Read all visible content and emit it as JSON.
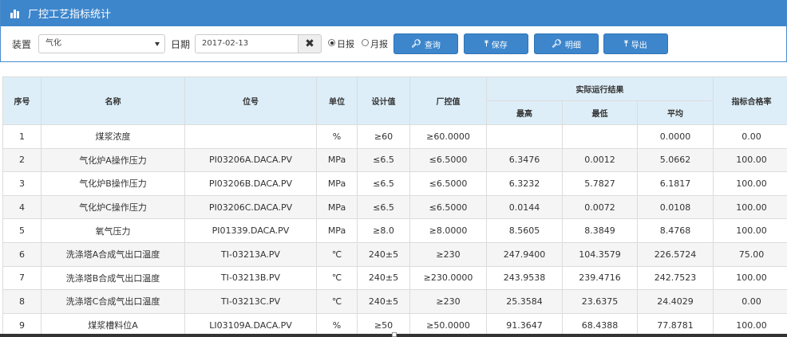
{
  "header": {
    "title": "厂控工艺指标统计",
    "icon": "bar-chart-icon"
  },
  "toolbar": {
    "device_label": "装置",
    "device_value": "气化",
    "date_label": "日期",
    "date_value": "2017-02-13",
    "clear_icon": "✖",
    "radio_day": "日报",
    "radio_month": "月报",
    "selected_radio": "日报",
    "btn_query": "查询",
    "btn_save": "保存",
    "btn_detail": "明细",
    "btn_export": "导出"
  },
  "table": {
    "headers": {
      "seq": "序号",
      "name": "名称",
      "tag": "位号",
      "unit": "单位",
      "design": "设计值",
      "control": "厂控值",
      "actual_group": "实际运行结果",
      "max": "最高",
      "min": "最低",
      "avg": "平均",
      "rate": "指标合格率"
    },
    "rows": [
      {
        "seq": "1",
        "name": "煤浆浓度",
        "tag": "",
        "unit": "%",
        "design": "≥60",
        "control": "≥60.0000",
        "max": "",
        "min": "",
        "avg": "0.0000",
        "rate": "0.00"
      },
      {
        "seq": "2",
        "name": "气化炉A操作压力",
        "tag": "PI03206A.DACA.PV",
        "unit": "MPa",
        "design": "≤6.5",
        "control": "≤6.5000",
        "max": "6.3476",
        "min": "0.0012",
        "avg": "5.0662",
        "rate": "100.00"
      },
      {
        "seq": "3",
        "name": "气化炉B操作压力",
        "tag": "PI03206B.DACA.PV",
        "unit": "MPa",
        "design": "≤6.5",
        "control": "≤6.5000",
        "max": "6.3232",
        "min": "5.7827",
        "avg": "6.1817",
        "rate": "100.00"
      },
      {
        "seq": "4",
        "name": "气化炉C操作压力",
        "tag": "PI03206C.DACA.PV",
        "unit": "MPa",
        "design": "≤6.5",
        "control": "≤6.5000",
        "max": "0.0144",
        "min": "0.0072",
        "avg": "0.0108",
        "rate": "100.00"
      },
      {
        "seq": "5",
        "name": "氧气压力",
        "tag": "PI01339.DACA.PV",
        "unit": "MPa",
        "design": "≥8.0",
        "control": "≥8.0000",
        "max": "8.5605",
        "min": "8.3849",
        "avg": "8.4768",
        "rate": "100.00"
      },
      {
        "seq": "6",
        "name": "洗涤塔A合成气出口温度",
        "tag": "TI-03213A.PV",
        "unit": "℃",
        "design": "240±5",
        "control": "≥230",
        "max": "247.9400",
        "min": "104.3579",
        "avg": "226.5724",
        "rate": "75.00"
      },
      {
        "seq": "7",
        "name": "洗涤塔B合成气出口温度",
        "tag": "TI-03213B.PV",
        "unit": "℃",
        "design": "240±5",
        "control": "≥230.0000",
        "max": "243.9538",
        "min": "239.4716",
        "avg": "242.7523",
        "rate": "100.00"
      },
      {
        "seq": "8",
        "name": "洗涤塔C合成气出口温度",
        "tag": "TI-03213C.PV",
        "unit": "℃",
        "design": "240±5",
        "control": "≥230",
        "max": "25.3584",
        "min": "23.6375",
        "avg": "24.4029",
        "rate": "0.00"
      },
      {
        "seq": "9",
        "name": "煤浆槽料位A",
        "tag": "LI03109A.DACA.PV",
        "unit": "%",
        "design": "≥50",
        "control": "≥50.0000",
        "max": "91.3647",
        "min": "68.4388",
        "avg": "77.8781",
        "rate": "100.00"
      }
    ]
  }
}
